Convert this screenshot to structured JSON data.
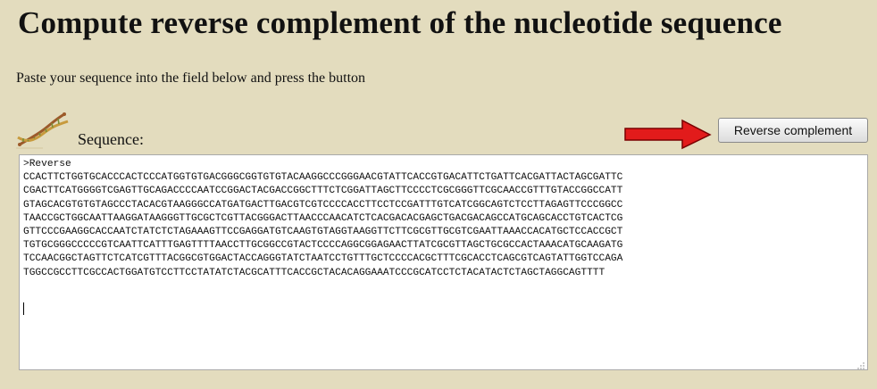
{
  "header": {
    "title": "Compute reverse complement of the nucleotide sequence",
    "instructions": "Paste your sequence into the field below and press the button"
  },
  "form": {
    "icon": "dna-helix-icon",
    "label": "Sequence:",
    "pointer_icon": "red-arrow-icon",
    "button_label": "Reverse complement",
    "sequence_lines": [
      ">Reverse",
      "CCACTTCTGGTGCACCCACTCCCATGGTGTGACGGGCGGTGTGTACAAGGCCCGGGAACGTATTCACCGTGACATTCTGATTCACGATTACTAGCGATTC",
      "CGACTTCATGGGGTCGAGTTGCAGACCCCAATCCGGACTACGACCGGCTTTCTCGGATTAGCTTCCCCTCGCGGGTTCGCAACCGTTTGTACCGGCCATT",
      "GTAGCACGTGTGTAGCCCTACACGTAAGGGCCATGATGACTTGACGTCGTCCCCACCTTCCTCCGATTTGTCATCGGCAGTCTCCTTAGAGTTCCCGGCC",
      "TAACCGCTGGCAATTAAGGATAAGGGTTGCGCTCGTTACGGGACTTAACCCAACATCTCACGACACGAGCTGACGACAGCCATGCAGCACCTGTCACTCG",
      "GTTCCCGAAGGCACCAATCTATCTCTAGAAAGTTCCGAGGATGTCAAGTGTAGGTAAGGTTCTTCGCGTTGCGTCGAATTAAACCACATGCTCCACCGCT",
      "TGTGCGGGCCCCCGTCAATTCATTTGAGTTTTAACCTTGCGGCCGTACTCCCCAGGCGGAGAACTTATCGCGTTAGCTGCGCCACTAAACATGCAAGATG",
      "TCCAACGGCTAGTTCTCATCGTTTACGGCGTGGACTACCAGGGTATCTAATCCTGTTTGCTCCCCACGCTTTCGCACCTCAGCGTCAGTATTGGTCCAGA",
      "TGGCCGCCTTCGCCACTGGATGTCCTTCCTATATCTACGCATTTCACCGCTACACAGGAAATCCCGCATCCTCTACATACTCTAGCTAGGCAGTTTT"
    ]
  }
}
